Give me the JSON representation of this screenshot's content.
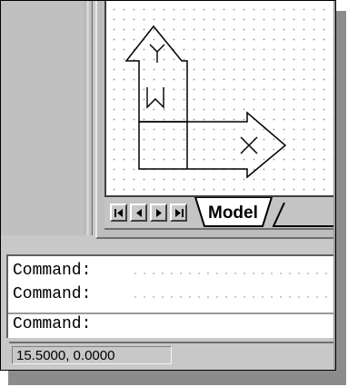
{
  "tabs": {
    "model_label": "Model"
  },
  "nav_buttons": [
    {
      "name": "first-tab-button",
      "icon": "first-icon"
    },
    {
      "name": "prev-tab-button",
      "icon": "prev-icon"
    },
    {
      "name": "next-tab-button",
      "icon": "next-icon"
    },
    {
      "name": "last-tab-button",
      "icon": "last-icon"
    }
  ],
  "command": {
    "history": [
      "Command:",
      "Command:"
    ],
    "prompt": "Command:"
  },
  "status": {
    "coordinates": "15.5000, 0.0000"
  },
  "ucs_icon": {
    "x_label": "X",
    "y_label": "Y",
    "w_label": "W"
  },
  "colors": {
    "window_bg": "#c8c8c8",
    "drawing_bg": "#ffffff",
    "accent": "#000000"
  }
}
